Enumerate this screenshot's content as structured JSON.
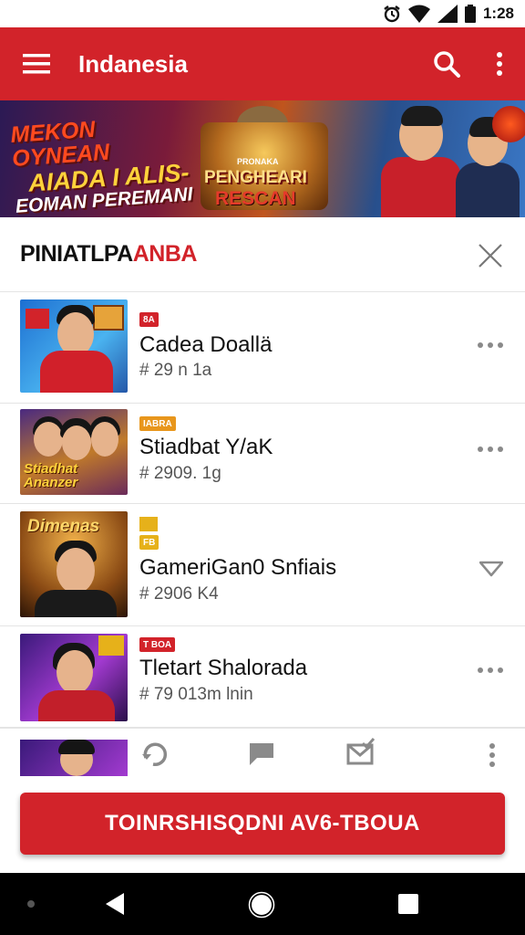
{
  "status_bar": {
    "time": "1:28"
  },
  "app_bar": {
    "title": "Indanesia"
  },
  "banner": {
    "line1": "MEKON OYNEAN",
    "line2": "AIADA I ALIS-",
    "line3": "EOMAN PEREMANI",
    "logo_tag": "PRONAKA",
    "logo_line1": "PENGHEARI",
    "logo_line2": "RESCAN"
  },
  "section": {
    "title_main": "PINIATLPA",
    "title_accent": "ANBA"
  },
  "items": [
    {
      "badge": "8A",
      "title": "Cadea Doallä",
      "meta": "# 29 n 1a",
      "action": "more",
      "thumb_text": ""
    },
    {
      "badge": "IABRA",
      "title": "Stiadbat Y/aK",
      "meta": "# 2909. 1g",
      "action": "more",
      "thumb_text": "Stiadhat Ananzer"
    },
    {
      "badge": "FB",
      "title": "GameriGan0 Snfiais",
      "meta": "# 2906 K4",
      "action": "expand",
      "thumb_text": "Dimenas"
    },
    {
      "badge": "T BOA",
      "title": "Tletart Shalorada",
      "meta": "# 79 013m lnin",
      "action": "more",
      "thumb_text": ""
    }
  ],
  "cta": {
    "label": "TOINRSHISQDNI AV6-TBOUA"
  },
  "colors": {
    "brand_red": "#d2232a",
    "badge_red": "#d2232a",
    "badge_orange": "#e8961c",
    "badge_yellow": "#e6b11a"
  }
}
